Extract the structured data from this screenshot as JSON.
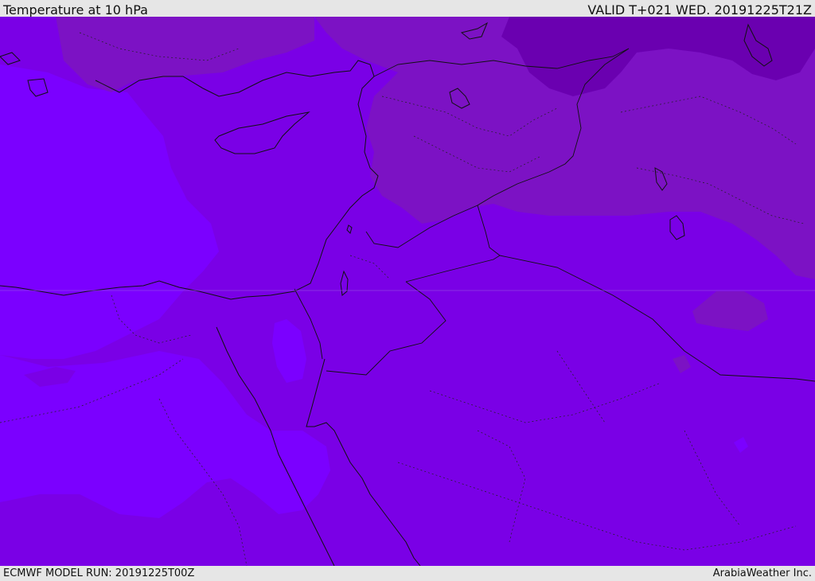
{
  "header": {
    "title": "Temperature at 10 hPa",
    "valid": "VALID T+021 WED. 20191225T21Z"
  },
  "footer": {
    "model_run": "ECMWF MODEL RUN: 20191225T00Z",
    "credit": "ArabiaWeather Inc."
  },
  "colors": {
    "field_bright": "#7b00ff",
    "field_mid": "#7a00e6",
    "field_dark": "#7c12c4",
    "field_darkest": "#6a00b0",
    "coastline": "#111111"
  }
}
